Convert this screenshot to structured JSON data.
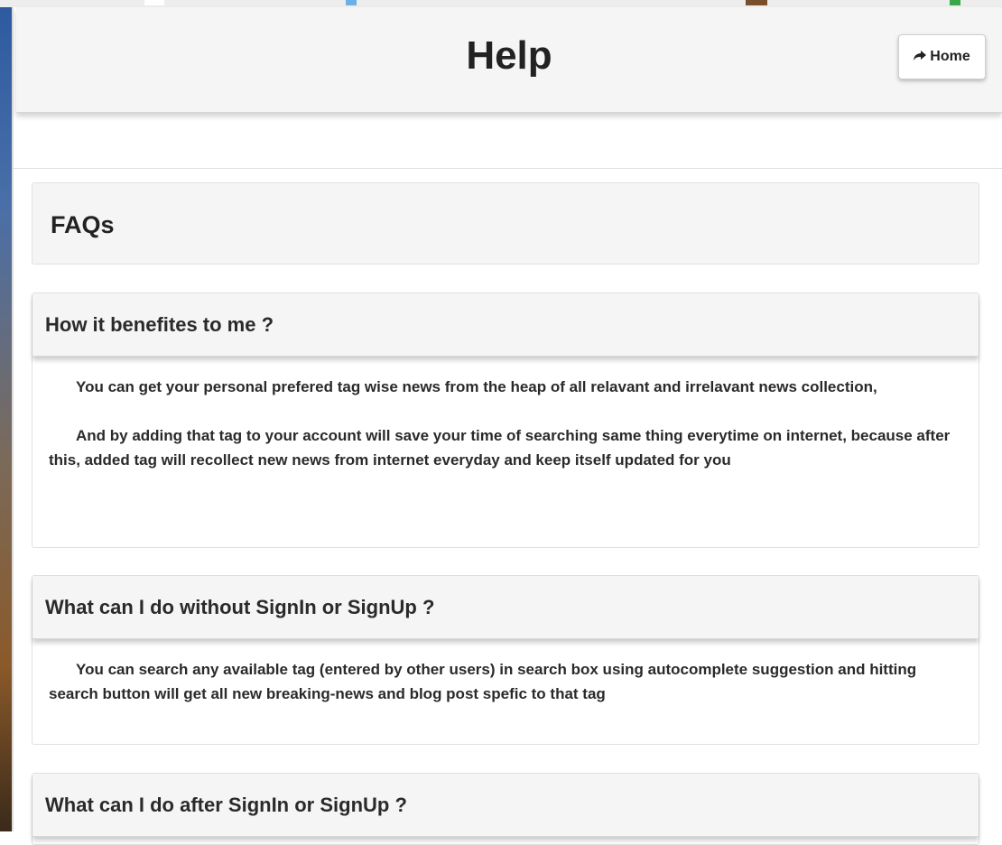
{
  "header": {
    "title": "Help",
    "home_button": "Home"
  },
  "faq": {
    "title": "FAQs",
    "items": [
      {
        "question": "How it benefites to me ?",
        "paragraphs": [
          "You can get your personal prefered tag wise news from the heap of all relavant and irrelavant news collection,",
          "And by adding that tag to your account will save your time of searching same thing everytime on internet, because after this, added tag will recollect new news from internet everyday and keep itself updated for you"
        ]
      },
      {
        "question": "What can I do without SignIn or SignUp ?",
        "paragraphs": [
          "You can search any available tag (entered by other users) in search box using autocomplete suggestion and hitting search button will get all new breaking-news and blog post spefic to that tag"
        ]
      },
      {
        "question": "What can I do after SignIn or SignUp ?"
      }
    ]
  },
  "icons": {
    "home": "share-arrow-icon"
  },
  "colors": {
    "header_bg": "#f5f5f5",
    "text": "#222222",
    "border": "#e0e0e0"
  }
}
